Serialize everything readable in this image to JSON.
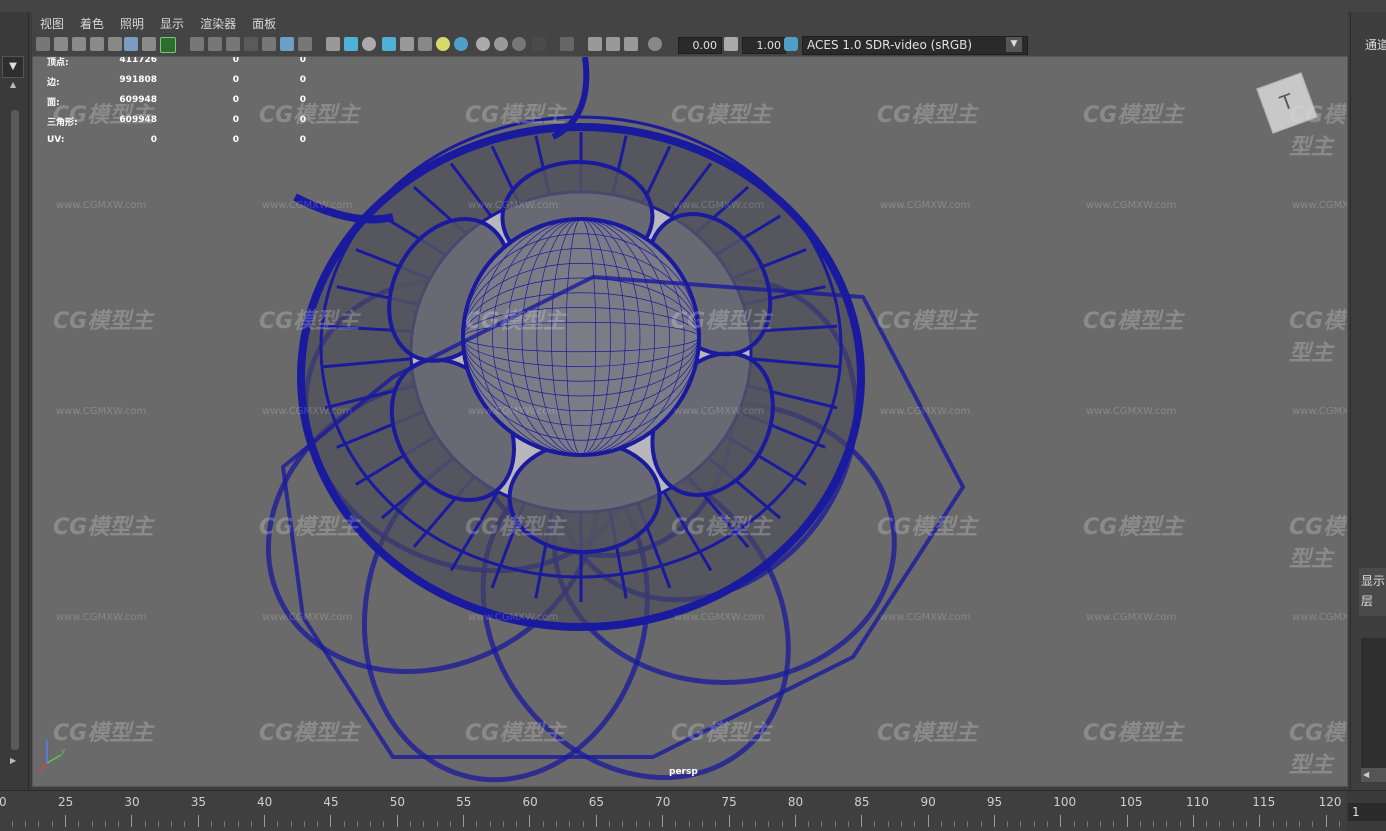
{
  "menubar": {
    "items": [
      "视图",
      "着色",
      "照明",
      "显示",
      "渲染器",
      "面板"
    ]
  },
  "toolbar": {
    "exposure_value": "0.00",
    "gamma_value": "1.00",
    "color_space": "ACES 1.0 SDR-video (sRGB)"
  },
  "hud": {
    "rows": [
      {
        "label": "顶点:",
        "v1": "411726",
        "v2": "0",
        "v3": "0"
      },
      {
        "label": "边:",
        "v1": "991808",
        "v2": "0",
        "v3": "0"
      },
      {
        "label": "面:",
        "v1": "609948",
        "v2": "0",
        "v3": "0"
      },
      {
        "label": "三角形:",
        "v1": "609948",
        "v2": "0",
        "v3": "0"
      },
      {
        "label": "UV:",
        "v1": "0",
        "v2": "0",
        "v3": "0"
      }
    ]
  },
  "viewport": {
    "camera_name": "persp",
    "view_cube_label": "T",
    "watermark_text": "CG模型主",
    "watermark_url": "www.CGMXW.com",
    "axis_labels": {
      "x": "x",
      "y": "y",
      "z": "z"
    },
    "wire_color": "#1a1a9e",
    "background_color": "#6a6a6a"
  },
  "right_panel": {
    "channel_label": "通道",
    "display_label": "显示",
    "layer_label": "层"
  },
  "timeline": {
    "start_label": "0",
    "tick_labels": [
      "25",
      "30",
      "35",
      "40",
      "45",
      "50",
      "55",
      "60",
      "65",
      "70",
      "75",
      "80",
      "85",
      "90",
      "95",
      "100",
      "105",
      "110",
      "115",
      "120"
    ],
    "current_frame": "1"
  }
}
